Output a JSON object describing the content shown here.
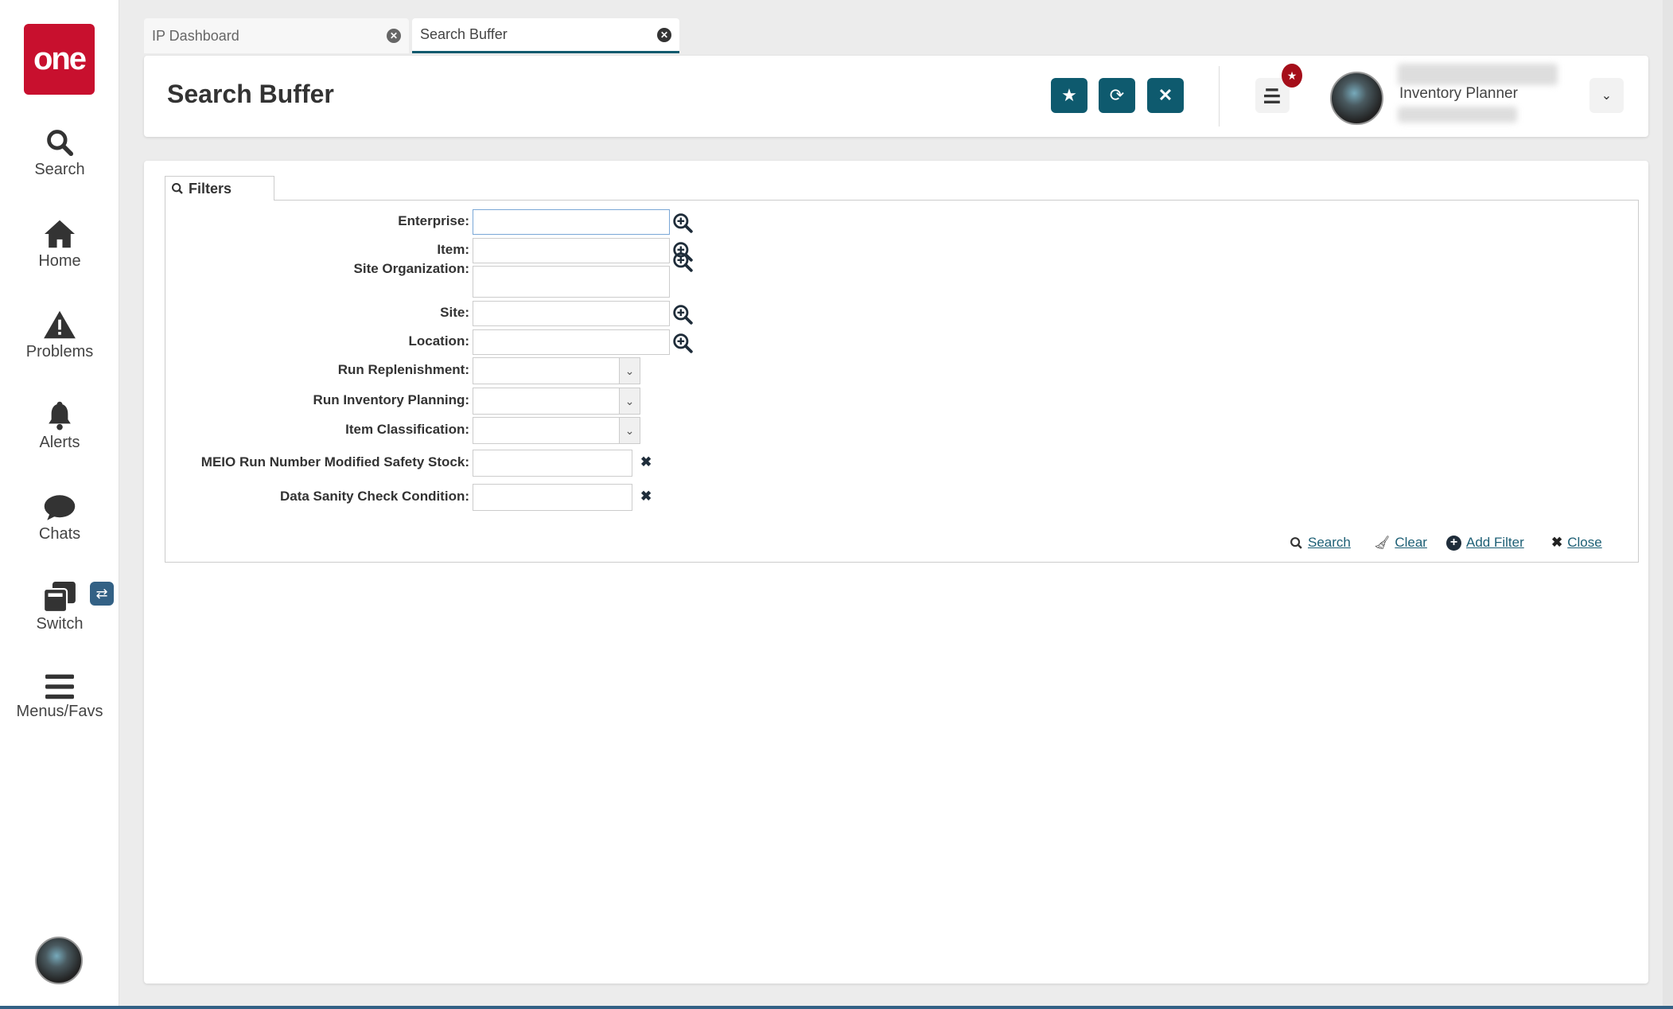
{
  "logo": "one",
  "sidebar": {
    "items": [
      {
        "label": "Search"
      },
      {
        "label": "Home"
      },
      {
        "label": "Problems"
      },
      {
        "label": "Alerts"
      },
      {
        "label": "Chats"
      },
      {
        "label": "Switch"
      },
      {
        "label": "Menus/Favs"
      }
    ]
  },
  "tabs": [
    {
      "label": "IP Dashboard"
    },
    {
      "label": "Search Buffer"
    }
  ],
  "header": {
    "title": "Search Buffer",
    "user_role": "Inventory Planner"
  },
  "filters": {
    "tab_label": "Filters",
    "fields": [
      {
        "label": "Enterprise:",
        "value": ""
      },
      {
        "label": "Item:",
        "value": ""
      },
      {
        "label": "Site Organization:",
        "value": ""
      },
      {
        "label": "Site:",
        "value": ""
      },
      {
        "label": "Location:",
        "value": ""
      },
      {
        "label": "Run Replenishment:",
        "value": ""
      },
      {
        "label": "Run Inventory Planning:",
        "value": ""
      },
      {
        "label": "Item Classification:",
        "value": ""
      },
      {
        "label": "MEIO Run Number Modified Safety Stock:",
        "value": ""
      },
      {
        "label": "Data Sanity Check Condition:",
        "value": ""
      }
    ],
    "actions": {
      "search": "Search",
      "clear": "Clear",
      "add_filter": "Add Filter",
      "close": "Close"
    }
  },
  "colors": {
    "brand": "#c8102e",
    "accent": "#0e5a6e",
    "link": "#1d5f75"
  }
}
